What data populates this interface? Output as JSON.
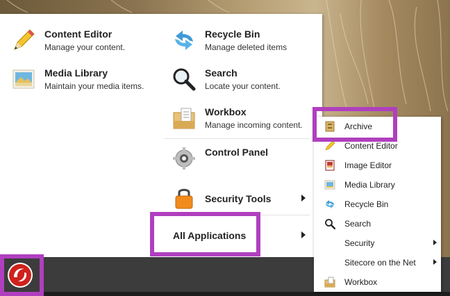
{
  "start_menu": {
    "left_column": [
      {
        "title": "Content Editor",
        "desc": "Manage your content."
      },
      {
        "title": "Media Library",
        "desc": "Maintain your media items."
      }
    ],
    "right_column": [
      {
        "title": "Recycle Bin",
        "desc": "Manage deleted items"
      },
      {
        "title": "Search",
        "desc": "Locate your content."
      },
      {
        "title": "Workbox",
        "desc": "Manage incoming content."
      },
      {
        "title": "Control Panel"
      },
      {
        "title": "Security Tools"
      },
      {
        "title": "All Applications"
      }
    ]
  },
  "submenu": {
    "items": [
      {
        "label": "Archive",
        "icon": "archive-icon"
      },
      {
        "label": "Content Editor",
        "icon": "pencil-icon"
      },
      {
        "label": "Image Editor",
        "icon": "image-editor-icon"
      },
      {
        "label": "Media Library",
        "icon": "media-library-icon"
      },
      {
        "label": "Recycle Bin",
        "icon": "recycle-icon"
      },
      {
        "label": "Search",
        "icon": "search-icon"
      },
      {
        "label": "Security"
      },
      {
        "label": "Sitecore on the Net"
      },
      {
        "label": "Workbox",
        "icon": "workbox-icon"
      }
    ]
  },
  "colors": {
    "highlight": "#b03fbf",
    "taskbar": "#3c3c3c",
    "start_button": "#d0211c"
  }
}
